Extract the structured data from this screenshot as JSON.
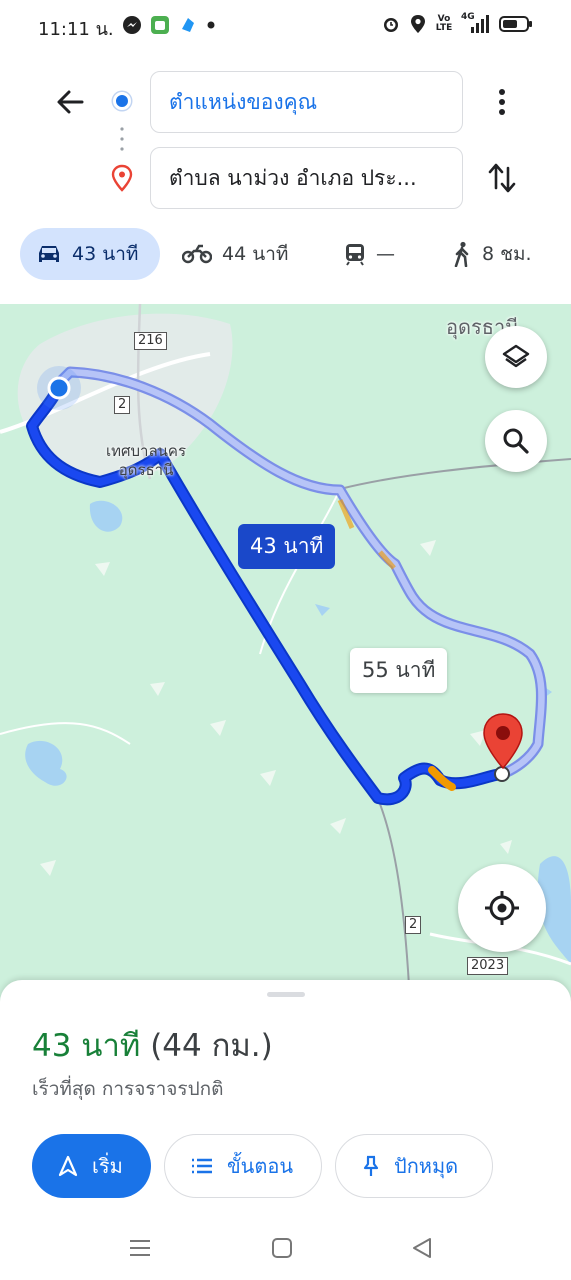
{
  "status_bar": {
    "time": "11:11 น.",
    "icons_left": [
      "messenger-icon",
      "android-app-icon",
      "app-icon",
      "notification-dot"
    ],
    "icons_right": [
      "alarm-icon",
      "location-icon",
      "volte-icon",
      "signal-4g-icon",
      "battery-icon"
    ],
    "volte_text": "Vo LTE",
    "network_text": "4G"
  },
  "directions": {
    "origin": "ตำแหน่งของคุณ",
    "destination": "ตำบล นาม่วง อำเภอ ประ..."
  },
  "modes": [
    {
      "name": "drive",
      "icon": "car-icon",
      "label": "43 นาที",
      "active": true
    },
    {
      "name": "motorcycle",
      "icon": "motorcycle-icon",
      "label": "44 นาที",
      "active": false
    },
    {
      "name": "transit",
      "icon": "train-icon",
      "label": "—",
      "active": false
    },
    {
      "name": "walk",
      "icon": "walking-icon",
      "label": "8 ชม.",
      "active": false
    }
  ],
  "map": {
    "places": [
      "เทศบาลนคร",
      "อุดรธานี",
      "อุดรธานี"
    ],
    "shields": [
      "216",
      "2",
      "2",
      "2023"
    ],
    "route_primary_label": "43 นาที",
    "route_alt_label": "55 นาที",
    "colors": {
      "route_primary": "#1a48f0",
      "route_alt": "#9fb0f0",
      "traffic": "#f29900",
      "land": "#cdf0dc",
      "water": "#a7d3f2"
    }
  },
  "sheet": {
    "duration": "43 นาที",
    "distance": "(44 กม.)",
    "subtitle": "เร็วที่สุด การจราจรปกติ",
    "start_label": "เริ่ม",
    "steps_label": "ขั้นตอน",
    "pin_label": "ปักหมุด"
  }
}
